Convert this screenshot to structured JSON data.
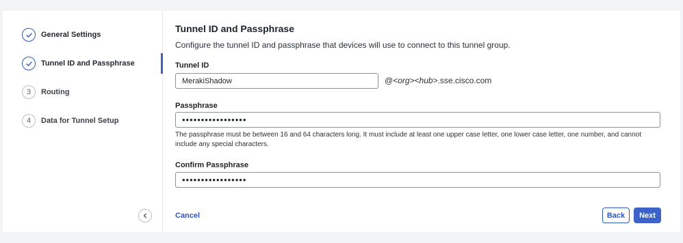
{
  "sidebar": {
    "steps": [
      {
        "number": "",
        "label": "General Settings",
        "state": "completed",
        "icon": "check-icon"
      },
      {
        "number": "",
        "label": "Tunnel ID and Passphrase",
        "state": "current",
        "icon": "check-icon"
      },
      {
        "number": "3",
        "label": "Routing",
        "state": "pending"
      },
      {
        "number": "4",
        "label": "Data for Tunnel Setup",
        "state": "pending"
      }
    ],
    "collapse_icon": "chevron-left-icon"
  },
  "main": {
    "title": "Tunnel ID and Passphrase",
    "subtitle": "Configure the tunnel ID and passphrase that devices will use to connect to this tunnel group.",
    "tunnel_id": {
      "label": "Tunnel ID",
      "value": "MerakiShadow",
      "suffix_prefix": "@",
      "suffix_org": "<org>",
      "suffix_hub": "<hub>",
      "suffix_domain": ".sse.cisco.com"
    },
    "passphrase": {
      "label": "Passphrase",
      "value": "•••••••••••••••••",
      "helper": "The passphrase must be between 16 and 64 characters long. It must include at least one upper case letter, one lower case letter, one number, and cannot include any special characters."
    },
    "confirm_passphrase": {
      "label": "Confirm Passphrase",
      "value": "•••••••••••••••••"
    }
  },
  "footer": {
    "cancel_label": "Cancel",
    "back_label": "Back",
    "next_label": "Next"
  },
  "colors": {
    "accent": "#2f57b7",
    "primary_button": "#3d63c9",
    "active_indicator": "#3b5fc4"
  }
}
